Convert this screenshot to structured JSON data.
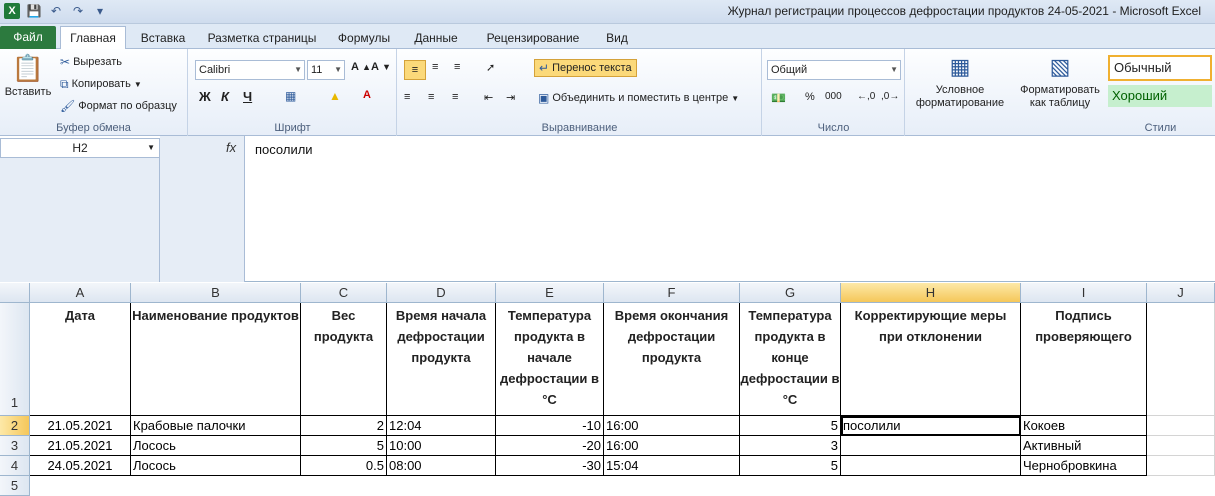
{
  "window": {
    "title": "Журнал регистрации процессов дефростации продуктов 24-05-2021  -  Microsoft Excel",
    "app_icon": "X"
  },
  "tabs": [
    "Файл",
    "Главная",
    "Вставка",
    "Разметка страницы",
    "Формулы",
    "Данные",
    "Рецензирование",
    "Вид"
  ],
  "ribbon": {
    "clipboard": {
      "paste": "Вставить",
      "cut": "Вырезать",
      "copy": "Копировать",
      "format_painter": "Формат по образцу",
      "label": "Буфер обмена"
    },
    "font": {
      "name": "Calibri",
      "size": "11",
      "bold": "Ж",
      "italic": "К",
      "underline": "Ч",
      "label": "Шрифт"
    },
    "alignment": {
      "wrap": "Перенос текста",
      "merge": "Объединить и поместить в центре",
      "label": "Выравнивание"
    },
    "number": {
      "format": "Общий",
      "percent": "%",
      "thousands": "000",
      "label": "Число"
    },
    "styles": {
      "conditional": "Условное форматирование",
      "as_table": "Форматировать как таблицу",
      "normal": "Обычный",
      "good": "Хороший",
      "label": "Стили"
    }
  },
  "formula_bar": {
    "name_box": "H2",
    "fx": "fx",
    "value": "посолили"
  },
  "columns": [
    "A",
    "B",
    "C",
    "D",
    "E",
    "F",
    "G",
    "H",
    "I",
    "J"
  ],
  "rows": [
    "1",
    "2",
    "3",
    "4",
    "5"
  ],
  "headers": {
    "A": "Дата",
    "B": "Наименование продуктов",
    "C": "Вес продукта",
    "D": "Время начала дефростации продукта",
    "E": "Температура продукта в начале дефростации в °С",
    "F": "Время окончания дефростации продукта",
    "G": "Температура продукта в конце дефростации в °С",
    "H": "Корректирующие меры при отклонении",
    "I": "Подпись проверяющего"
  },
  "table": [
    {
      "date": "21.05.2021",
      "product": "Крабовые палочки",
      "weight": "2",
      "start": "12:04",
      "t_start": "-10",
      "end": "16:00",
      "t_end": "5",
      "measures": "посолили",
      "sign": "Кокоев"
    },
    {
      "date": "21.05.2021",
      "product": "Лосось",
      "weight": "5",
      "start": "10:00",
      "t_start": "-20",
      "end": "16:00",
      "t_end": "3",
      "measures": "",
      "sign": "Активный"
    },
    {
      "date": "24.05.2021",
      "product": "Лосось",
      "weight": "0.5",
      "start": "08:00",
      "t_start": "-30",
      "end": "15:04",
      "t_end": "5",
      "measures": "",
      "sign": "Чернобровкина"
    }
  ]
}
